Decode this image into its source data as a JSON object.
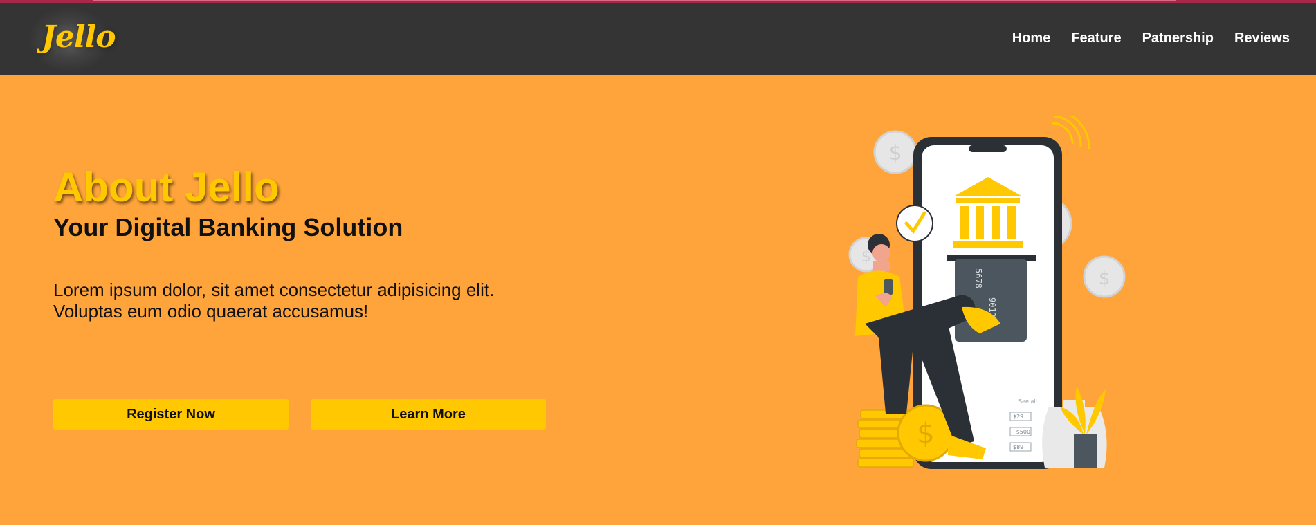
{
  "brand": {
    "logo_text": "Jello"
  },
  "nav": {
    "items": [
      {
        "label": "Home"
      },
      {
        "label": "Feature"
      },
      {
        "label": "Patnership"
      },
      {
        "label": "Reviews"
      }
    ]
  },
  "hero": {
    "title": "About Jello",
    "subtitle": "Your Digital Banking Solution",
    "lead_line1": "Lorem ipsum dolor, sit amet consectetur adipisicing elit.",
    "lead_line2": "Voluptas eum odio quaerat accusamus!",
    "register_label": "Register Now",
    "learn_label": "Learn More"
  },
  "illustration": {
    "card_digits_1": "5678",
    "card_digits_2": "9012",
    "amount_1": "$29",
    "amount_2": "+$500",
    "amount_3": "$89",
    "see_all": "See all",
    "icon": "banking-phone-illustration"
  },
  "colors": {
    "header_bg": "#343434",
    "hero_bg": "#ffa43a",
    "accent": "#ffc800",
    "top_line": "#a8274a"
  }
}
